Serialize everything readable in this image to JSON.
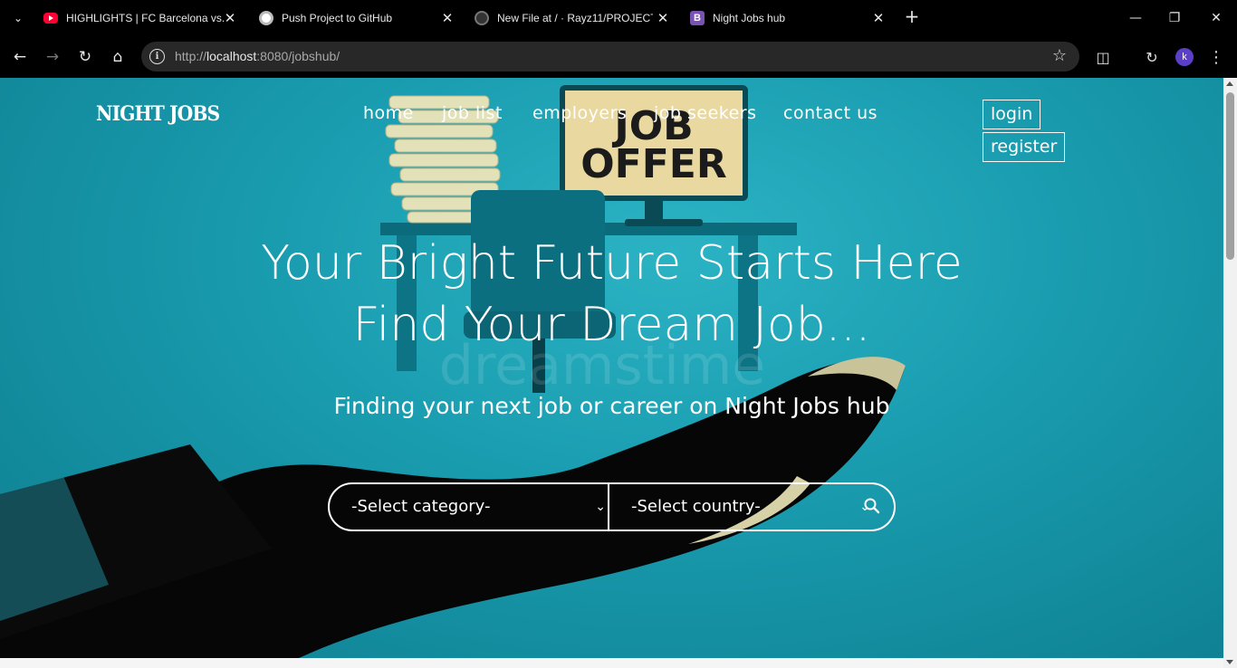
{
  "browser": {
    "tabs": [
      {
        "title": "HIGHLIGHTS | FC Barcelona vs. I",
        "icon": "youtube-icon"
      },
      {
        "title": "Push Project to GitHub",
        "icon": "chatgpt-icon"
      },
      {
        "title": "New File at / · Rayz11/PROJECT-",
        "icon": "github-icon"
      },
      {
        "title": "Night Jobs hub",
        "icon": "bootstrap-icon"
      }
    ],
    "url_prefix": "http://",
    "url_host": "localhost",
    "url_rest": ":8080/jobshub/",
    "profile_initial": "k"
  },
  "site": {
    "brand": "NIGHT JOBS",
    "nav": [
      "home",
      "job list",
      "employers",
      "job seekers",
      "contact us"
    ],
    "login_label": "login",
    "register_label": "register",
    "headline_line1": "Your Bright Future Starts Here",
    "headline_line2": "Find Your Dream Job...",
    "subheadline": "Finding your next job or career on Night Jobs hub",
    "search": {
      "category_selected": "-Select category-",
      "country_selected": "-Select country-"
    }
  },
  "hero_image": {
    "poster_line1": "JOB",
    "poster_line2": "OFFER",
    "watermark": "dreamstime"
  },
  "colors": {
    "hero_teal": "#1a9db0",
    "poster_yellow": "#e9d9a0",
    "hand_black": "#060606"
  }
}
